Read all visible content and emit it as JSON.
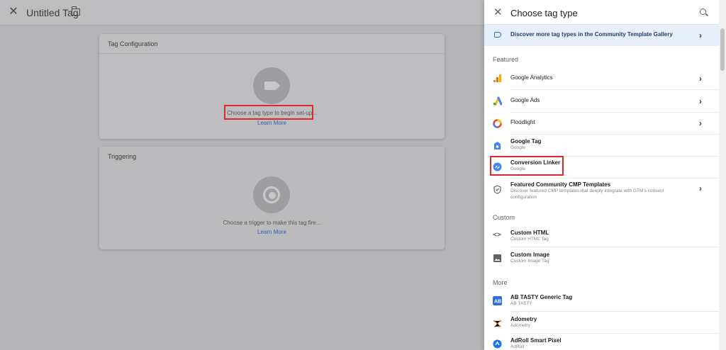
{
  "editor": {
    "title": "Untitled Tag",
    "tag_config": {
      "heading": "Tag Configuration",
      "prompt": "Choose a tag type to begin set-up...",
      "link": "Learn More"
    },
    "triggering": {
      "heading": "Triggering",
      "prompt": "Choose a trigger to make this tag fire...",
      "link": "Learn More"
    }
  },
  "panel": {
    "title": "Choose tag type",
    "gallery": "Discover more tag types in the Community Template Gallery",
    "sections": {
      "featured": "Featured",
      "custom": "Custom",
      "more": "More"
    },
    "featured": [
      {
        "name": "Google Analytics",
        "sub": ""
      },
      {
        "name": "Google Ads",
        "sub": ""
      },
      {
        "name": "Floodlight",
        "sub": ""
      },
      {
        "name": "Google Tag",
        "sub": "Google"
      },
      {
        "name": "Conversion Linker",
        "sub": "Google"
      },
      {
        "name": "Featured Community CMP Templates",
        "sub": "Discover featured CMP templates that deeply integrate with GTM's consent configuration"
      }
    ],
    "custom": [
      {
        "name": "Custom HTML",
        "sub": "Custom HTML Tag"
      },
      {
        "name": "Custom Image",
        "sub": "Custom Image Tag"
      }
    ],
    "more": [
      {
        "name": "AB TASTY Generic Tag",
        "sub": "AB TASTY"
      },
      {
        "name": "Adometry",
        "sub": "Adometry"
      },
      {
        "name": "AdRoll Smart Pixel",
        "sub": "AdRoll"
      }
    ]
  },
  "colors": {
    "accent": "#1a73e8",
    "highlight": "#d9282f",
    "overlay": "#b4b4b6"
  }
}
